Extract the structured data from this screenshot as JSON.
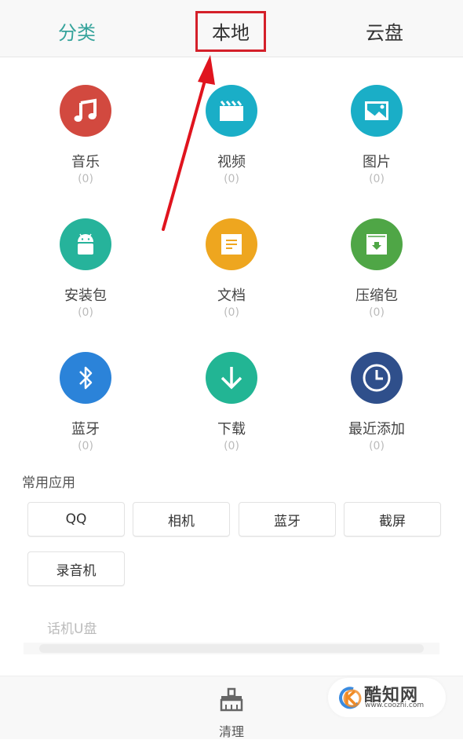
{
  "tabs": [
    {
      "label": "分类",
      "active": true
    },
    {
      "label": "本地",
      "active": false,
      "highlighted": true
    },
    {
      "label": "云盘",
      "active": false
    }
  ],
  "categories": [
    {
      "label": "音乐",
      "count": "(0)",
      "icon": "music-note-icon",
      "color": "#d2493f"
    },
    {
      "label": "视频",
      "count": "(0)",
      "icon": "clapperboard-icon",
      "color": "#1aaec7"
    },
    {
      "label": "图片",
      "count": "(0)",
      "icon": "picture-icon",
      "color": "#1aaec7"
    },
    {
      "label": "安装包",
      "count": "(0)",
      "icon": "android-icon",
      "color": "#26b39b"
    },
    {
      "label": "文档",
      "count": "(0)",
      "icon": "document-icon",
      "color": "#eea61f"
    },
    {
      "label": "压缩包",
      "count": "(0)",
      "icon": "archive-icon",
      "color": "#4fa646"
    },
    {
      "label": "蓝牙",
      "count": "(0)",
      "icon": "bluetooth-icon",
      "color": "#2b83d9"
    },
    {
      "label": "下载",
      "count": "(0)",
      "icon": "download-arrow-icon",
      "color": "#22b594"
    },
    {
      "label": "最近添加",
      "count": "(0)",
      "icon": "clock-icon",
      "color": "#2f4f8b"
    }
  ],
  "common_apps": {
    "title": "常用应用",
    "items": [
      "QQ",
      "相机",
      "蓝牙",
      "截屏",
      "录音机"
    ]
  },
  "storage": {
    "label": "话机U盘"
  },
  "bottom": {
    "clean_label": "清理"
  },
  "watermark": {
    "name": "酷知网",
    "url": "www.coozhi.com"
  },
  "colors": {
    "accent": "#35a39b",
    "annotation": "#d4202a"
  }
}
